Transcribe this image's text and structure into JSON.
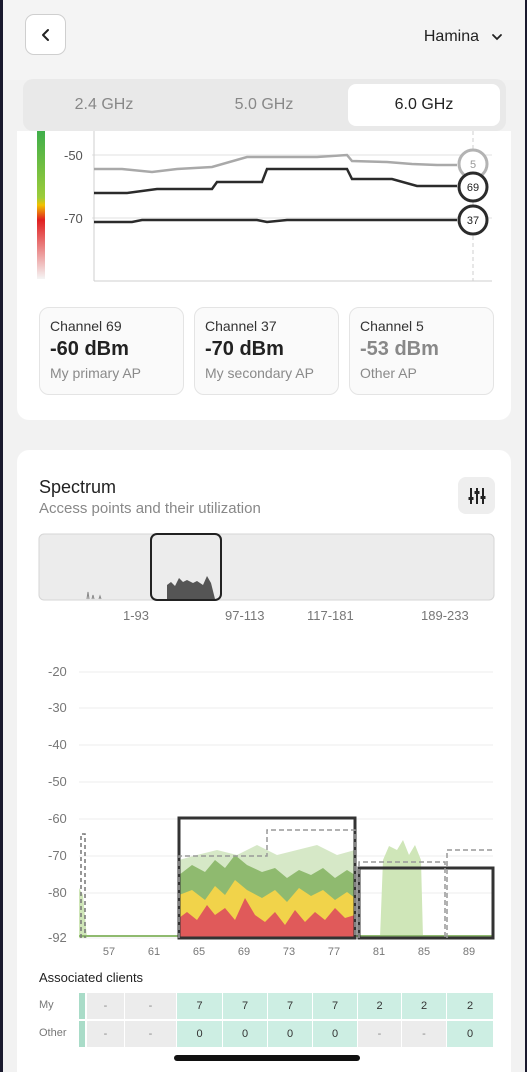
{
  "header": {
    "site_name": "Hamina"
  },
  "bands": [
    "2.4 GHz",
    "5.0 GHz",
    "6.0 GHz"
  ],
  "active_band": "6.0 GHz",
  "signal_chart": {
    "y_ticks": [
      "-50",
      "-70"
    ],
    "markers": [
      "5",
      "69",
      "37"
    ]
  },
  "channels": [
    {
      "channel": "Channel 69",
      "value": "-60 dBm",
      "role": "My primary AP"
    },
    {
      "channel": "Channel 37",
      "value": "-70 dBm",
      "role": "My secondary AP"
    },
    {
      "channel": "Channel 5",
      "value": "-53 dBm",
      "role": "Other AP"
    }
  ],
  "spectrum": {
    "title": "Spectrum",
    "subtitle": "Access points and their utilization",
    "overview_labels": [
      "1-93",
      "97-113",
      "117-181",
      "189-233"
    ]
  },
  "chart_data": {
    "type": "area",
    "title": "",
    "xlabel": "",
    "ylabel": "",
    "ylim": [
      -92,
      -20
    ],
    "y_ticks": [
      "-20",
      "-30",
      "-40",
      "-50",
      "-60",
      "-70",
      "-80",
      "-92"
    ],
    "x_ticks": [
      "57",
      "61",
      "65",
      "69",
      "73",
      "77",
      "81",
      "85",
      "89"
    ],
    "series": [
      {
        "name": "",
        "values": [
          -92,
          -64,
          -64,
          -92
        ]
      },
      {
        "name": "",
        "values": [
          -70,
          -60,
          -60,
          -60,
          -60,
          -60,
          -60,
          -60
        ]
      },
      {
        "name": "",
        "values": [
          -92,
          -74,
          -74,
          -92
        ]
      },
      {
        "name": "",
        "values": [
          -92,
          -72,
          -72,
          -92
        ]
      },
      {
        "name": "",
        "values": [
          -92,
          -68,
          -68,
          -92
        ]
      }
    ],
    "colors": {
      "red": "#e05a5a",
      "yellow": "#f1d34a",
      "green": "#8fba6f",
      "light_green": "#cfe6b8"
    }
  },
  "clients": {
    "title": "Associated clients",
    "rows": [
      {
        "label": "My",
        "cells": [
          "-",
          "-",
          "7",
          "7",
          "7",
          "7",
          "2",
          "2",
          "2"
        ]
      },
      {
        "label": "Other",
        "cells": [
          "-",
          "-",
          "0",
          "0",
          "0",
          "0",
          "-",
          "-",
          "0"
        ]
      }
    ]
  }
}
